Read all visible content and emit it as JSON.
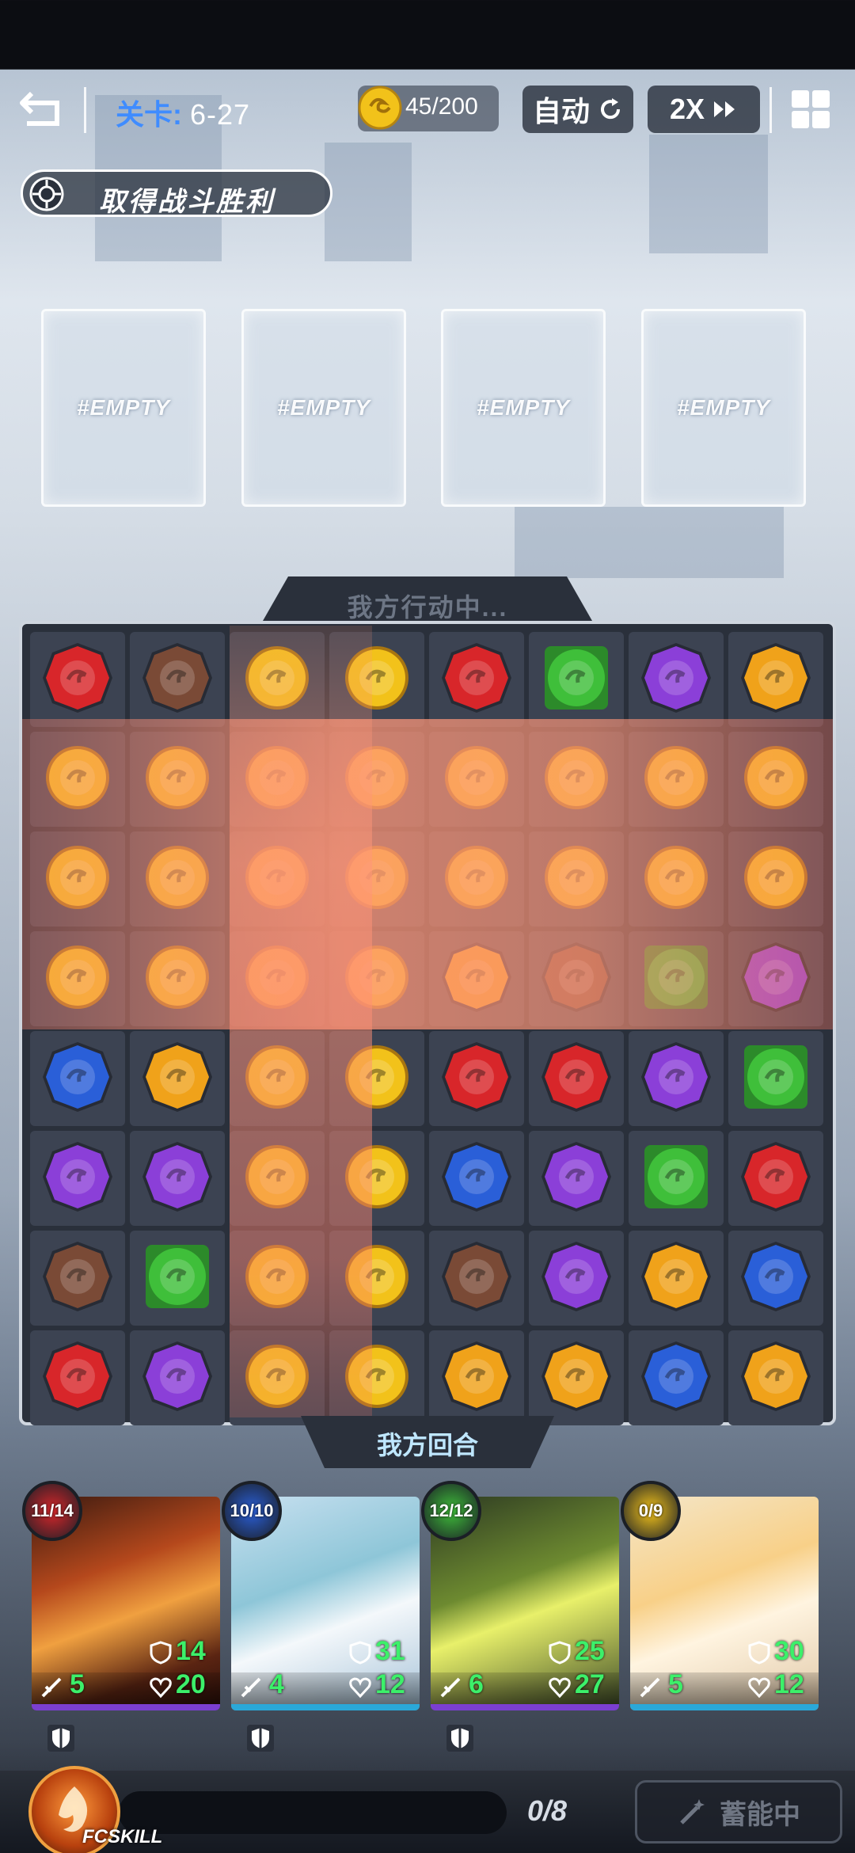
{
  "topbar": {
    "level_label": "关卡:",
    "level_value": "6-27",
    "coins": "45/200",
    "auto_label": "自动",
    "speed_label": "2X"
  },
  "objective": {
    "text": "取得战斗胜利"
  },
  "slots": [
    "#EMPTY",
    "#EMPTY",
    "#EMPTY",
    "#EMPTY"
  ],
  "board": {
    "status_top": "我方行动中...",
    "status_bottom": "我方回合",
    "grid": [
      [
        "red",
        "brown",
        "gold",
        "gold",
        "red",
        "green",
        "purple",
        "orange"
      ],
      [
        "gold",
        "gold",
        "gold",
        "gold",
        "gold",
        "gold",
        "gold",
        "gold"
      ],
      [
        "gold",
        "gold",
        "gold",
        "gold",
        "gold",
        "gold",
        "gold",
        "gold"
      ],
      [
        "gold",
        "gold",
        "gold",
        "gold",
        "orange",
        "brown",
        "green",
        "purple"
      ],
      [
        "blue",
        "orange",
        "gold",
        "gold",
        "red",
        "red",
        "purple",
        "green"
      ],
      [
        "purple",
        "purple",
        "gold",
        "gold",
        "blue",
        "purple",
        "green",
        "red"
      ],
      [
        "brown",
        "green",
        "gold",
        "gold",
        "brown",
        "purple",
        "orange",
        "blue"
      ],
      [
        "red",
        "purple",
        "gold",
        "gold",
        "orange",
        "orange",
        "blue",
        "orange"
      ]
    ]
  },
  "heroes": [
    {
      "hp": "11/14",
      "element": "red",
      "shield": "14",
      "heart": "20",
      "attack": "5",
      "bar": "#7b3fd0"
    },
    {
      "hp": "10/10",
      "element": "blue",
      "shield": "31",
      "heart": "12",
      "attack": "4",
      "bar": "#2aa8d8"
    },
    {
      "hp": "12/12",
      "element": "green",
      "shield": "25",
      "heart": "27",
      "attack": "6",
      "bar": "#7b3fd0"
    },
    {
      "hp": "0/9",
      "element": "gold",
      "shield": "30",
      "heart": "12",
      "attack": "5",
      "bar": "#2aa8d8"
    }
  ],
  "footer": {
    "fcskill_label": "FCSKILL",
    "charge_count": "0/8",
    "charge_label": "蓄能中"
  },
  "colors": {
    "red": "#d8262a",
    "brown": "#7a4a36",
    "gold": "#f2c21a",
    "green": "#3fbf3a",
    "purple": "#8b3fd8",
    "orange": "#f0a21a",
    "blue": "#2a5fd8"
  },
  "icons": {
    "back": "back-arrow-icon",
    "coin": "coin-icon",
    "auto": "refresh-icon",
    "speed": "fast-forward-icon",
    "menu": "grid-menu-icon",
    "objective": "crosshair-icon",
    "shield": "shield-icon",
    "heart": "heart-icon",
    "attack": "sword-icon",
    "charge": "magic-wand-icon"
  }
}
